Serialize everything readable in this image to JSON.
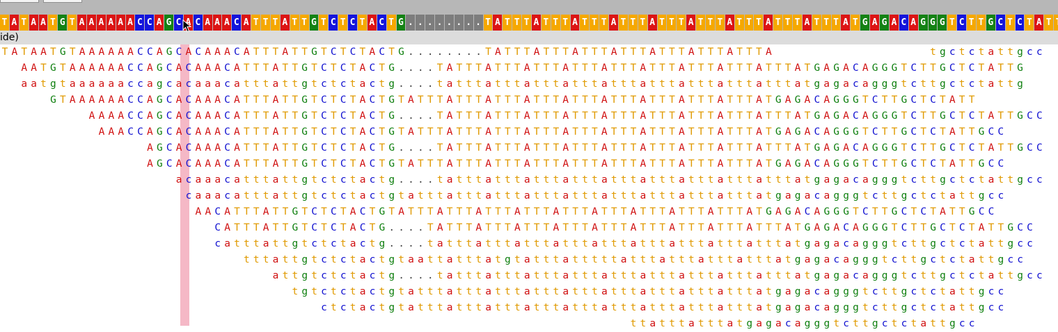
{
  "reference": {
    "sequence": "TATAATGTAAAAAACCAGCACAAACATTTATTGTCTCTACTG........TATTTATTTATTTATTTATTTATTTATTTATTTATTTATGAGACAGGGTCTTGCTCTATTGCC"
  },
  "strand_label": "ide)",
  "reads": [
    {
      "offset": 0,
      "bases": "TATAATGTAAAAAACCAGCACAAACATTTATTGTCTCTACTG........TATTTATTTATTTATTTATTTATTTATTTA                tgctctattgcc"
    },
    {
      "offset": 2,
      "bases": "AATGTAAAAAACCAGCACAAACATTTATTGTCTCTACTG....TATTTATTTATTTATTTATTTATTTATTTATTTATTTATGAGACAGGGTCTTGCTCTATTG"
    },
    {
      "offset": 2,
      "bases": "aatgtaaaaaaccagcacaaacatttattgtctctactg....tatttatttatttatttatttatttatttatttatttatgagacagggtcttgctctattg"
    },
    {
      "offset": 5,
      "bases": "GTAAAAAACCAGCACAAACATTTATTGTCTCTACTGTATTTATTTATTTATTTATTTATTTATTTATTTATTTATGAGACAGGGTCTTGCTCTATT"
    },
    {
      "offset": 9,
      "bases": "AAAACCAGCACAAACATTTATTGTCTCTACTG....TATTTATTTATTTATTTATTTATTTATTTATTTATTTATGAGACAGGGTCTTGCTCTATTGCC"
    },
    {
      "offset": 10,
      "bases": "AAACCAGCACAAACATTTATTGTCTCTACTGTATTTATTTATTTATTTATTTATTTATTTATTTATTTATGAGACAGGGTCTTGCTCTATTGCC"
    },
    {
      "offset": 15,
      "bases": "AGCACAAACATTTATTGTCTCTACTG....TATTTATTTATTTATTTATTTATTTATTTATTTATTTATGAGACAGGGTCTTGCTCTATTGCC"
    },
    {
      "offset": 15,
      "bases": "AGCACAAACATTTATTGTCTCTACTGTATTTATTTATTTATTTATTTATTTATTTATTTATTTATGAGACAGGGTCTTGCTCTATTGCC"
    },
    {
      "offset": 18,
      "bases": "acaaacatttattgtctctactg....tatttatttatttatttatttatttatttatttatttatgagacagggtcttgctctattgcc"
    },
    {
      "offset": 18,
      "bases": "-caaacatttattgtctctactgtatttatttatttatttatttatttatttatttatttatgagacagggtcttgctctattgcc"
    },
    {
      "offset": 18,
      "bases": "- AACATTTATTGTCTCTACTGTATTTATTTATTTATTTATTTATTTATTTATTTATTTATGAGACAGGGTCTTGCTCTATTGCC"
    },
    {
      "offset": 18,
      "bases": "-   CATTTATTGTCTCTACTG....TATTTATTTATTTATTTATTTATTTATTTATTTATTTATGAGACAGGGTCTTGCTCTATTGCC"
    },
    {
      "offset": 18,
      "bases": "-   catttattgtctctactg....tatttatttatttatttatttatttatttatttatttatgagacagggtcttgctctattgcc"
    },
    {
      "offset": 18,
      "bases": "-      tttattgtctctactgtaattatttatgtatttatttttatttatttatttatttatgagacagggtcttgctctattgcc"
    },
    {
      "offset": 18,
      "bases": "-         attgtctctactg....tatttatttatttatttatttatttatttatttatttatgagacagggtcttgctctattgcc"
    },
    {
      "offset": 18,
      "bases": "-           tgtctctactgtatttatttatttatttatttatttatttatttatttatgagacagggtcttgctctattgcc"
    },
    {
      "offset": 18,
      "bases": "-              ctctactgtatttatttatttatttatttatttatttatttatttatgagacagggtcttgctctattgcc"
    },
    {
      "offset": 18,
      "bases": "-                                              ttatttatttatgagacagggtcttgctctattgcc"
    }
  ]
}
